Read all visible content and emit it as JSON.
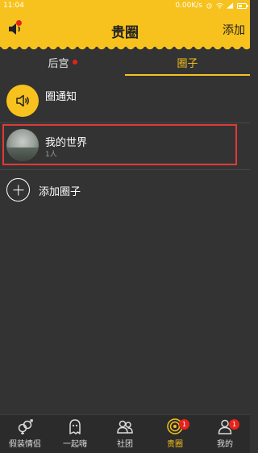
{
  "status_bar": {
    "time": "11:04",
    "network_speed": "0.00K/s"
  },
  "header": {
    "title": "贵圈",
    "add_label": "添加"
  },
  "tabs": [
    {
      "label": "后宫",
      "has_dot": true,
      "active": false
    },
    {
      "label": "圈子",
      "has_dot": false,
      "active": true
    }
  ],
  "notice": {
    "label": "圈通知"
  },
  "circle": {
    "name": "我的世界",
    "member_count": "1人"
  },
  "add_circle": {
    "label": "添加圈子"
  },
  "bottom_nav": [
    {
      "label": "假装情侣",
      "icon": "couple-icon",
      "badge": null,
      "active": false
    },
    {
      "label": "一起嗨",
      "icon": "ghost-icon",
      "badge": null,
      "active": false
    },
    {
      "label": "社团",
      "icon": "group-icon",
      "badge": null,
      "active": false
    },
    {
      "label": "贵圈",
      "icon": "target-circle-icon",
      "badge": "1",
      "active": true
    },
    {
      "label": "我的",
      "icon": "user-icon",
      "badge": "1",
      "active": false
    }
  ],
  "colors": {
    "accent": "#f7c21d",
    "background": "#333333",
    "highlight": "#e03a3a",
    "badge": "#e8221b"
  }
}
